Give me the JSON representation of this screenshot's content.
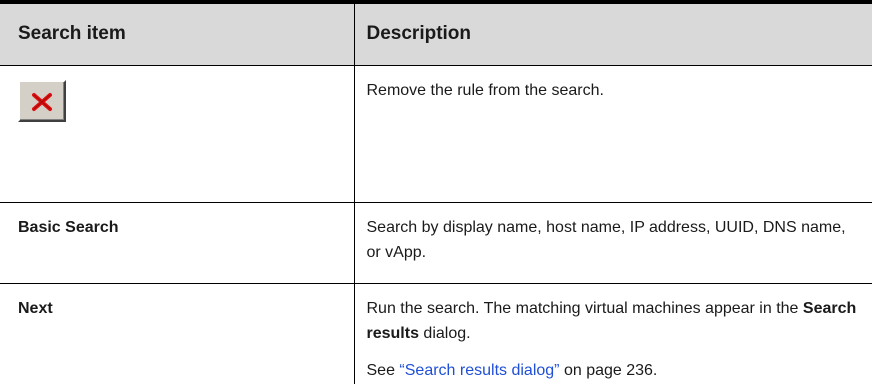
{
  "table": {
    "headers": {
      "item": "Search item",
      "description": "Description"
    },
    "rows": [
      {
        "item_icon": "remove-rule-x-icon",
        "description": "Remove the rule from the search."
      },
      {
        "item": "Basic Search",
        "description": "Search by display name, host name, IP address, UUID, DNS name, or vApp."
      },
      {
        "item": "Next",
        "description_pre": "Run the search. The matching virtual machines appear in the ",
        "description_bold": "Search results",
        "description_post": " dialog.",
        "see_prefix": "See ",
        "see_link": "“Search results dialog”",
        "see_suffix": " on page 236."
      }
    ]
  },
  "colors": {
    "header_bg": "#d9d9d9",
    "link": "#1f4fd6",
    "x_icon": "#e01010"
  }
}
